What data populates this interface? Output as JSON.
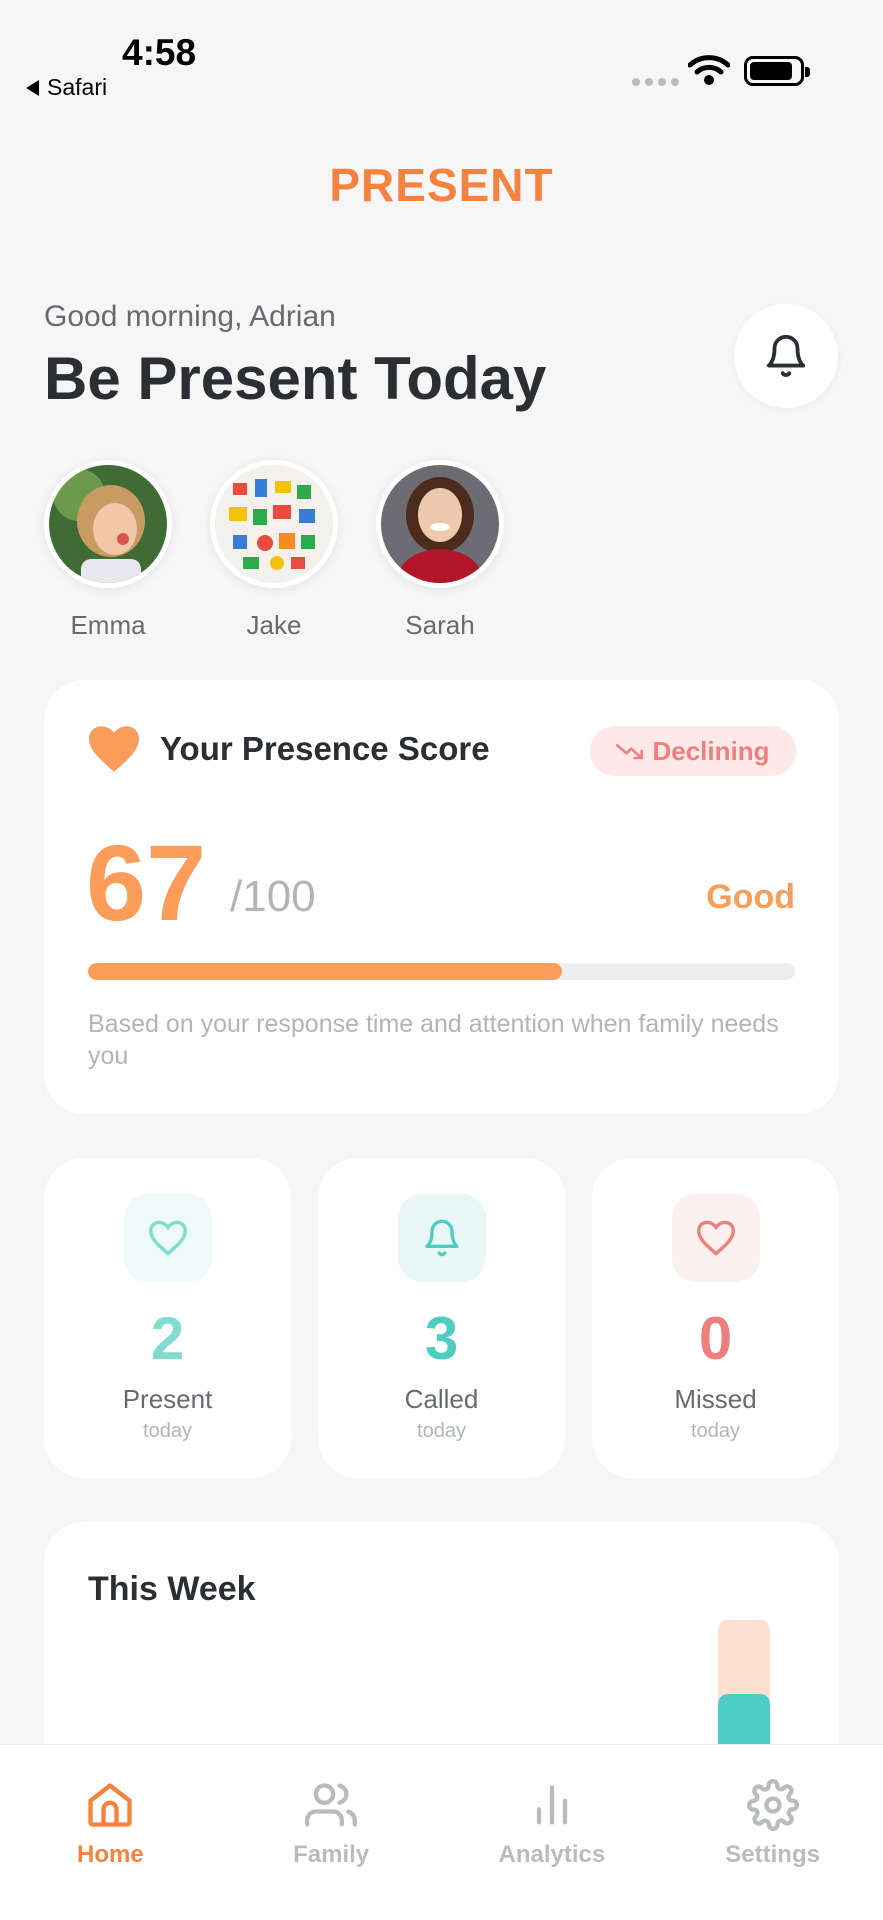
{
  "status_bar": {
    "time": "4:58",
    "back_label": "Safari"
  },
  "app": {
    "title": "PRESENT"
  },
  "header": {
    "greeting": "Good morning, Adrian",
    "headline": "Be Present Today"
  },
  "family": [
    {
      "name": "Emma"
    },
    {
      "name": "Jake"
    },
    {
      "name": "Sarah"
    }
  ],
  "presence": {
    "title": "Your Presence Score",
    "trend": "Declining",
    "score": "67",
    "max": "/100",
    "rating": "Good",
    "progress_percent": 67,
    "description": "Based on your response time and attention when family needs you"
  },
  "stats": [
    {
      "value": "2",
      "label": "Present",
      "sub": "today",
      "color": "#7fdccf",
      "icon": "heart-outline-icon"
    },
    {
      "value": "3",
      "label": "Called",
      "sub": "today",
      "color": "#4ecdc4",
      "icon": "bell-icon"
    },
    {
      "value": "0",
      "label": "Missed",
      "sub": "today",
      "color": "#ee7f7f",
      "icon": "heart-outline-icon"
    }
  ],
  "week": {
    "title": "This Week"
  },
  "tabs": [
    {
      "label": "Home",
      "icon": "home-icon",
      "active": true
    },
    {
      "label": "Family",
      "icon": "users-icon",
      "active": false
    },
    {
      "label": "Analytics",
      "icon": "bar-chart-icon",
      "active": false
    },
    {
      "label": "Settings",
      "icon": "gear-icon",
      "active": false
    }
  ],
  "colors": {
    "accent": "#f5823e",
    "score": "#fb9c5a",
    "teal": "#4ecdc4",
    "danger": "#ee7f7f"
  }
}
